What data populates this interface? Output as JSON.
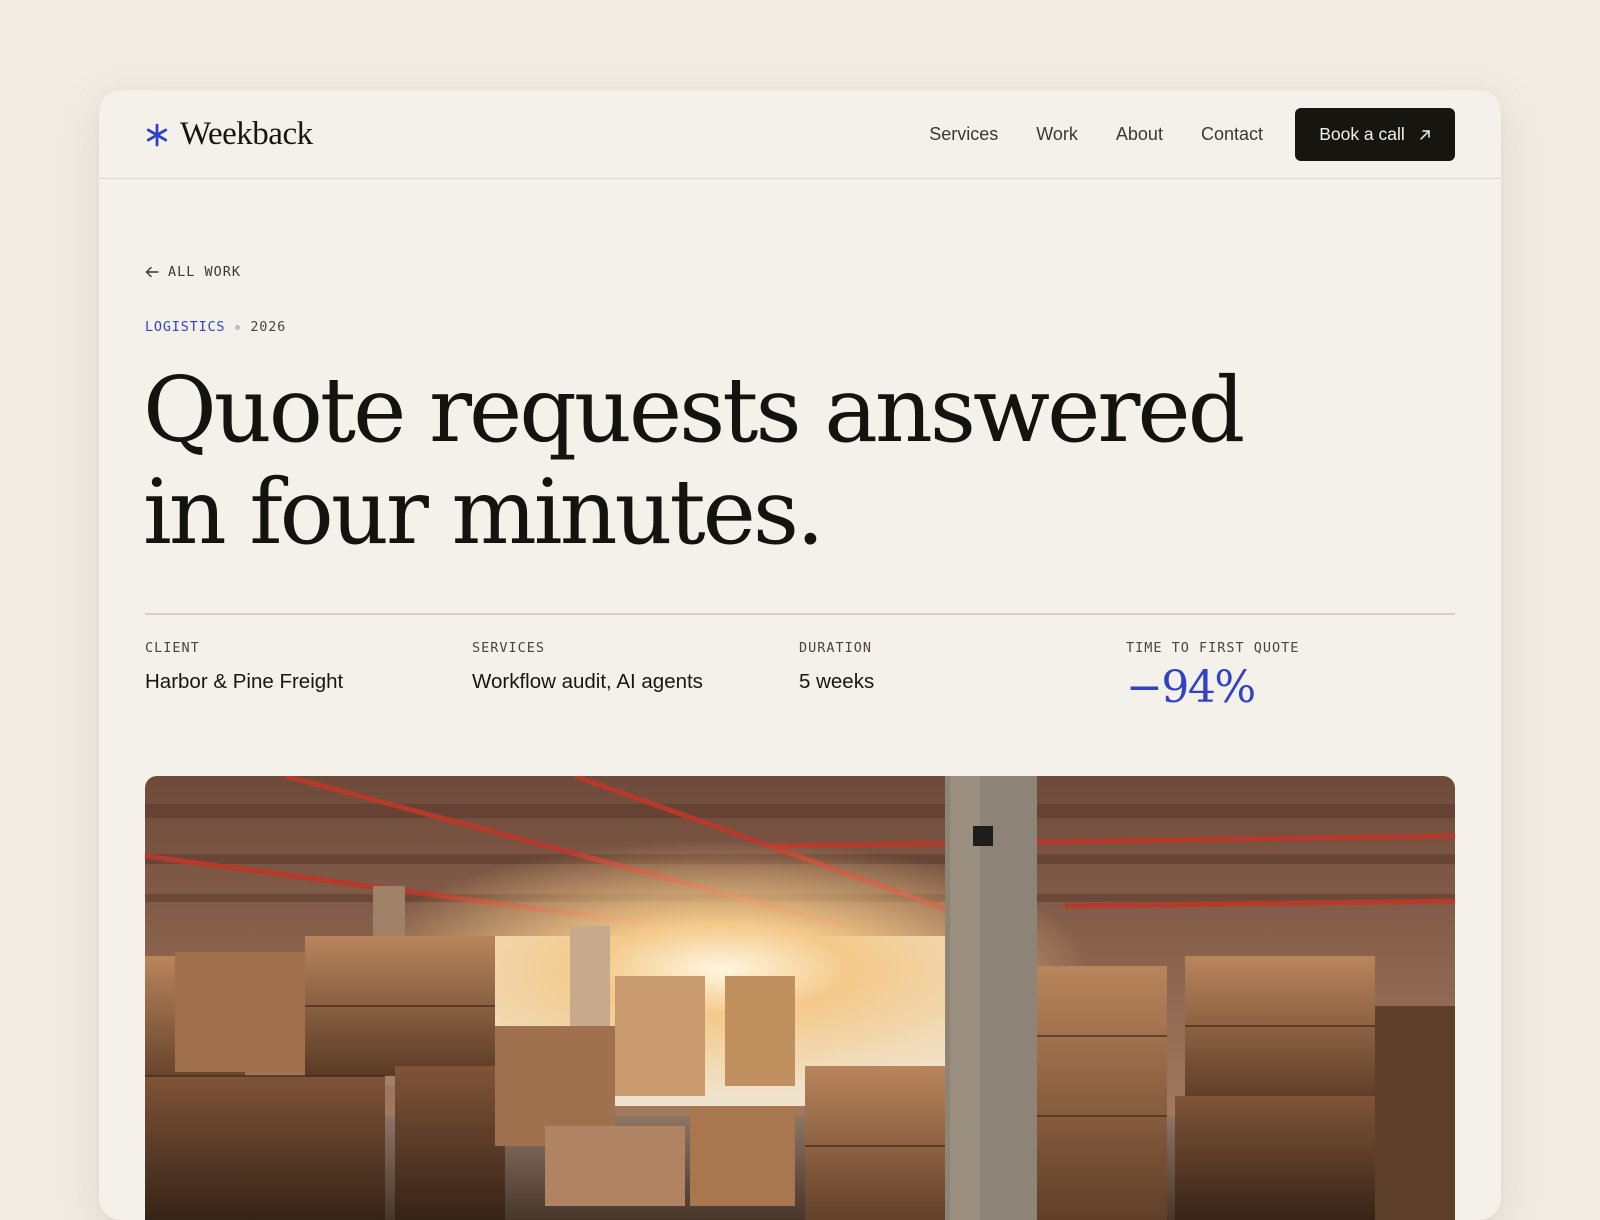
{
  "brand": {
    "name": "Weekback",
    "accent_color": "#3143c2"
  },
  "nav": {
    "links": [
      {
        "label": "Services"
      },
      {
        "label": "Work"
      },
      {
        "label": "About"
      },
      {
        "label": "Contact"
      }
    ],
    "cta_label": "Book a call",
    "cta_icon": "arrow-up-right-icon"
  },
  "back_link": {
    "label": "ALL WORK",
    "icon": "arrow-left-icon"
  },
  "meta": {
    "category": "LOGISTICS",
    "year": "2026"
  },
  "headline": {
    "line1": "Quote requests answered",
    "line2": "in four minutes."
  },
  "facts": [
    {
      "label": "CLIENT",
      "value": "Harbor & Pine Freight"
    },
    {
      "label": "SERVICES",
      "value": "Workflow audit, AI agents"
    },
    {
      "label": "DURATION",
      "value": "5 weeks"
    },
    {
      "label": "TIME TO FIRST QUOTE",
      "value": "−94%"
    }
  ],
  "colors": {
    "background": "#f1ede4",
    "surface": "#f4f1ea",
    "ink": "#18160f",
    "accent": "#3143c2",
    "button": "#17150f"
  }
}
